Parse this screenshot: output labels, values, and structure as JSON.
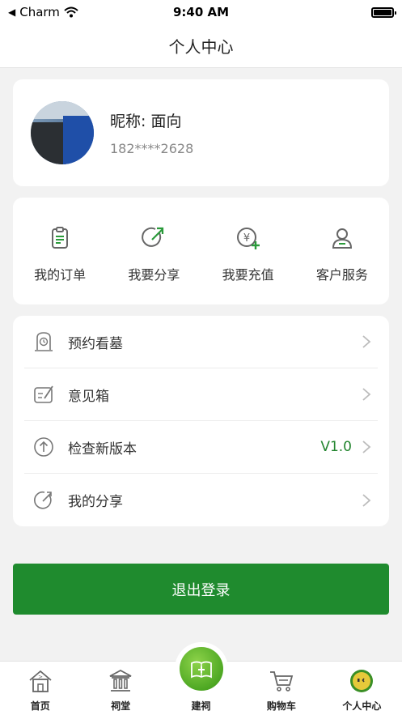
{
  "status_bar": {
    "carrier": "Charm",
    "time": "9:40 AM"
  },
  "nav": {
    "title": "个人中心"
  },
  "profile": {
    "nickname": "昵称: 面向",
    "phone": "182****2628"
  },
  "actions": [
    {
      "label": "我的订单",
      "icon": "clipboard-icon"
    },
    {
      "label": "我要分享",
      "icon": "share-arrow-icon"
    },
    {
      "label": "我要充值",
      "icon": "yuan-plus-icon"
    },
    {
      "label": "客户服务",
      "icon": "person-icon"
    }
  ],
  "menu": [
    {
      "label": "预约看墓",
      "icon": "tombstone-clock-icon",
      "value": ""
    },
    {
      "label": "意见箱",
      "icon": "feedback-edit-icon",
      "value": ""
    },
    {
      "label": "检查新版本",
      "icon": "upload-arrow-icon",
      "value": "V1.0"
    },
    {
      "label": "我的分享",
      "icon": "share-circle-icon",
      "value": ""
    }
  ],
  "logout_label": "退出登录",
  "tabs": [
    {
      "label": "首页",
      "icon": "home-icon"
    },
    {
      "label": "祠堂",
      "icon": "temple-icon"
    },
    {
      "label": "建祠",
      "icon": "build-hall-icon"
    },
    {
      "label": "购物车",
      "icon": "cart-icon"
    },
    {
      "label": "个人中心",
      "icon": "smiley-icon"
    }
  ],
  "colors": {
    "accent": "#1f8b2e",
    "value_green": "#23852f",
    "background": "#f2f2f2"
  }
}
